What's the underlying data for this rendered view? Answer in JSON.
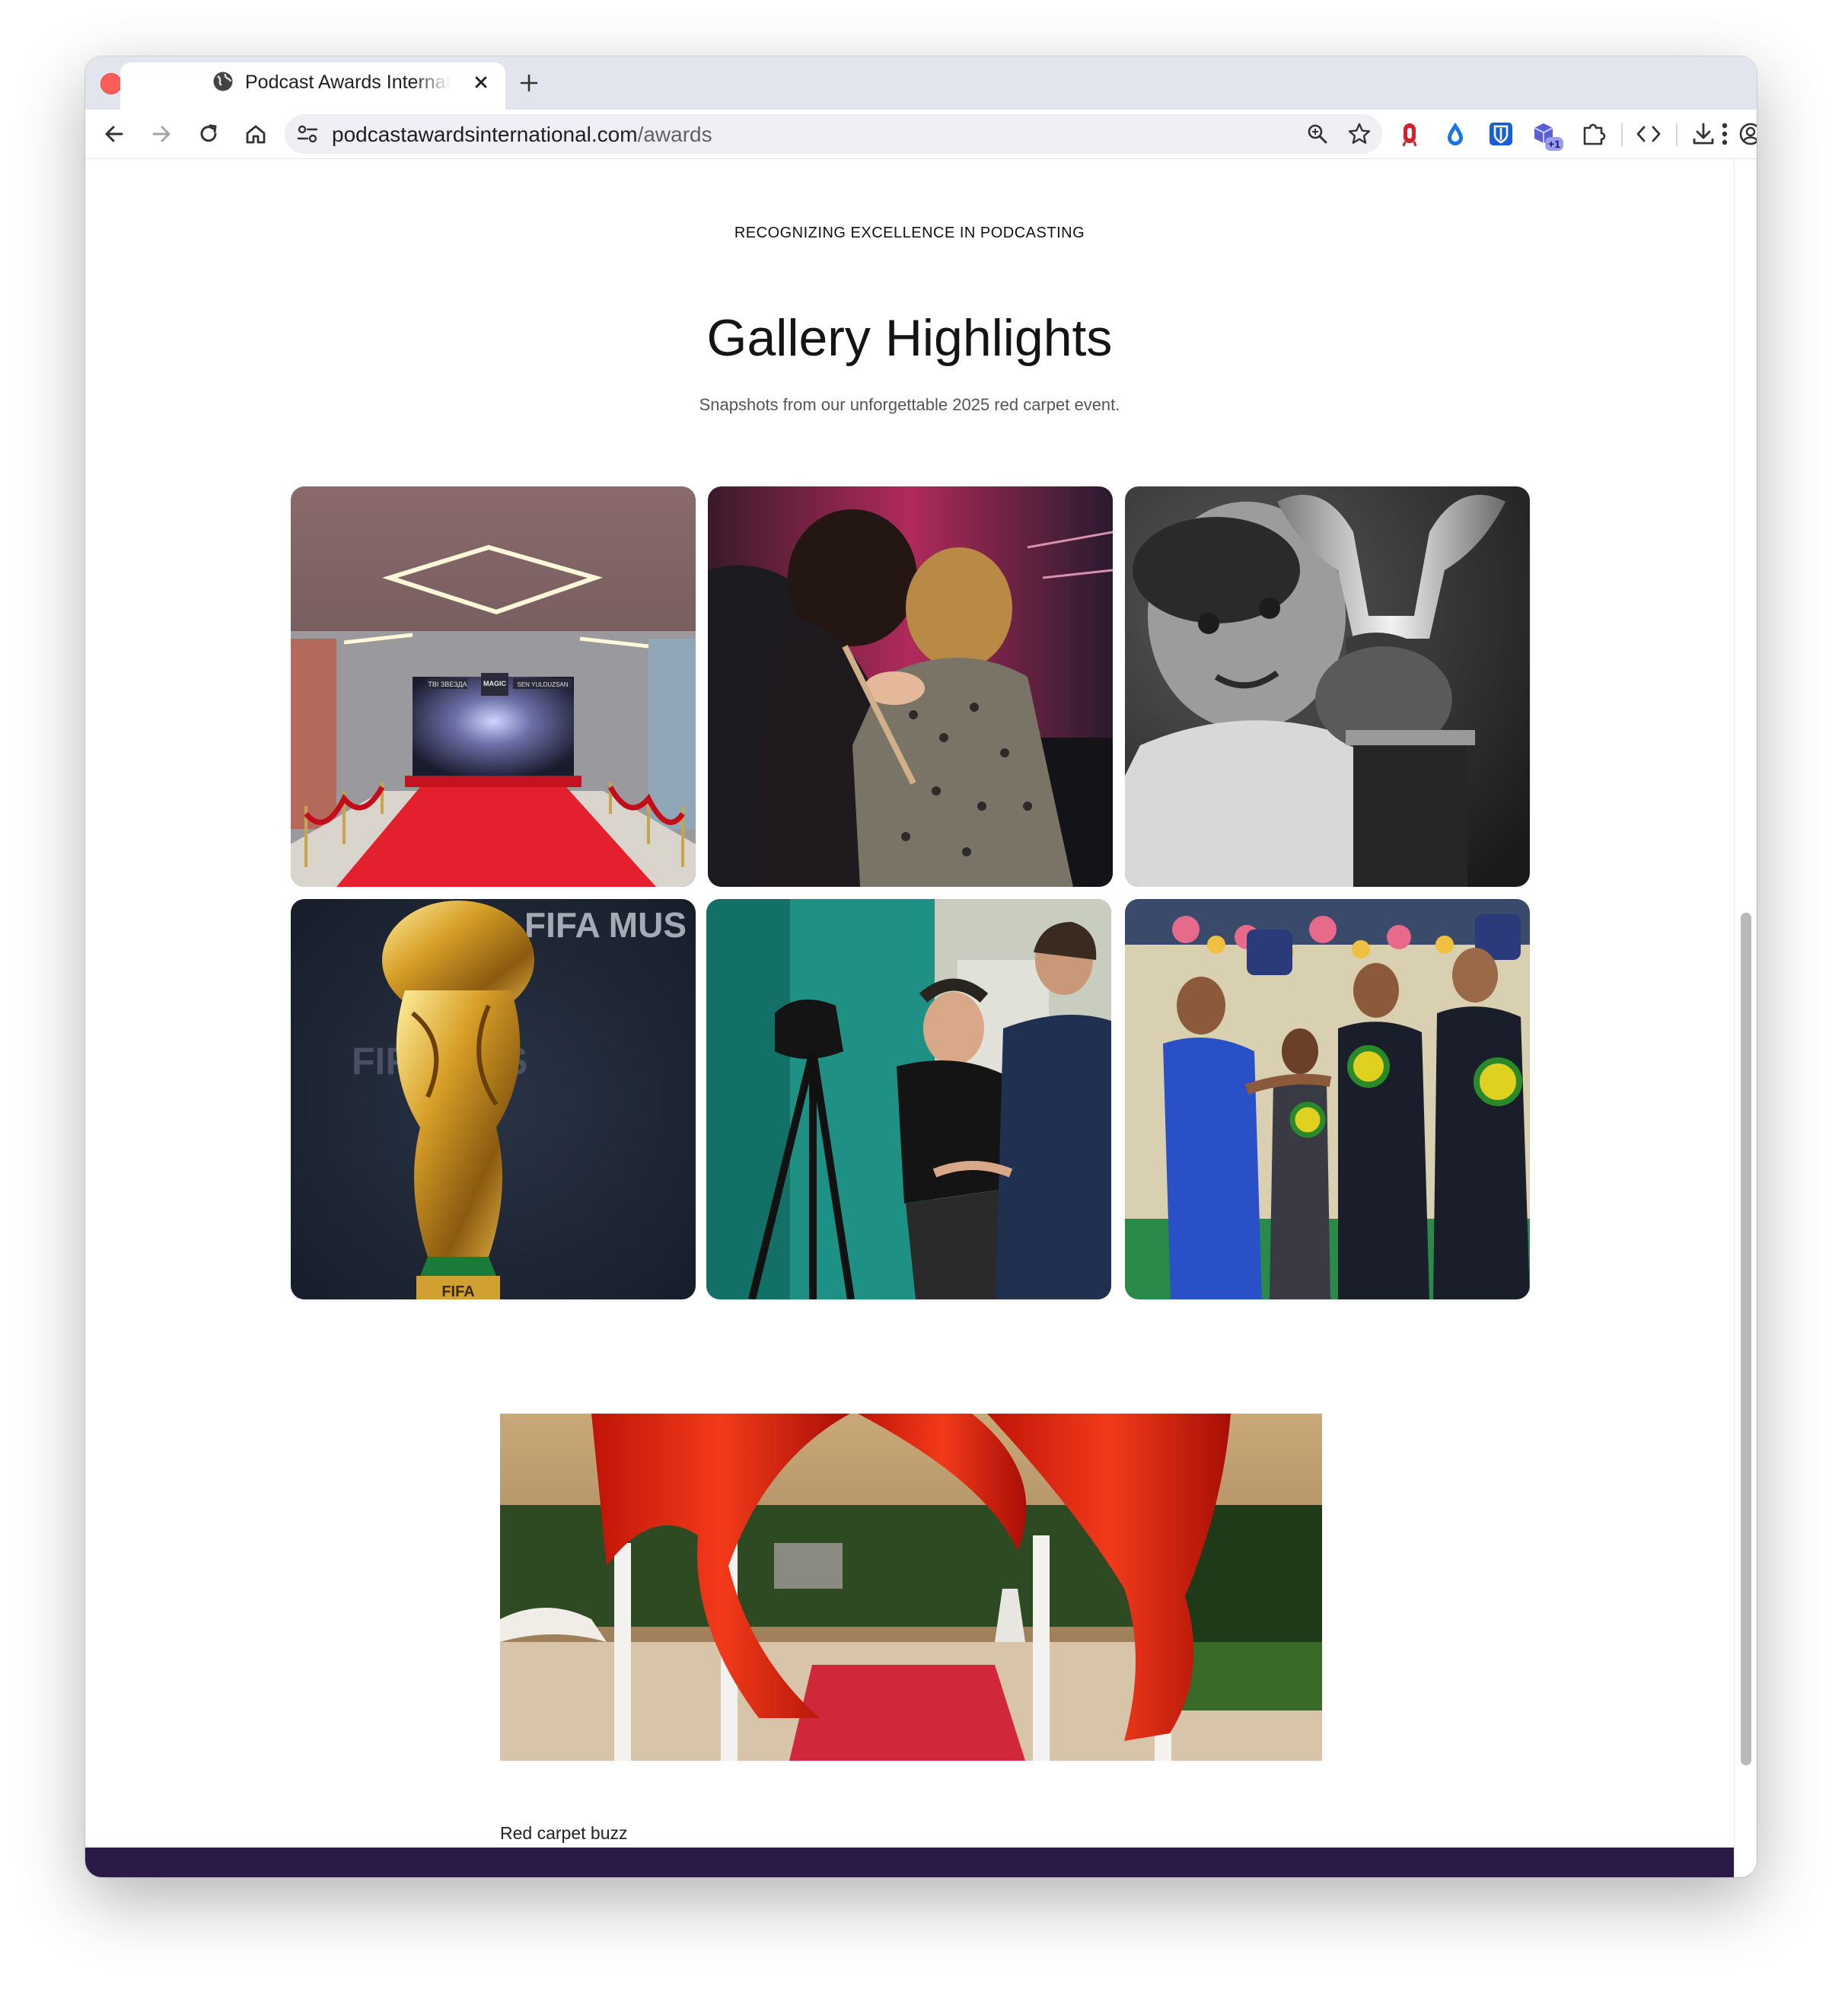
{
  "browser": {
    "tab_title": "Podcast Awards International",
    "url_host": "podcastawardsinternational.com",
    "url_path": "/awards",
    "extension_badge": "+1"
  },
  "page": {
    "tagline": "RECOGNIZING EXCELLENCE IN PODCASTING",
    "gallery_title": "Gallery Highlights",
    "gallery_subtitle": "Snapshots from our unforgettable 2025 red carpet event.",
    "feature_caption": "Red carpet buzz",
    "accent_color": "#2a1a45"
  },
  "gallery_text": {
    "sign_left": "ТВІ ЗВЕЗДА",
    "sign_center": "MAGIC",
    "sign_right": "SEN YULDUZSAN",
    "trophy_backdrop": "FIFA MUS",
    "trophy_base": "FIFA"
  }
}
